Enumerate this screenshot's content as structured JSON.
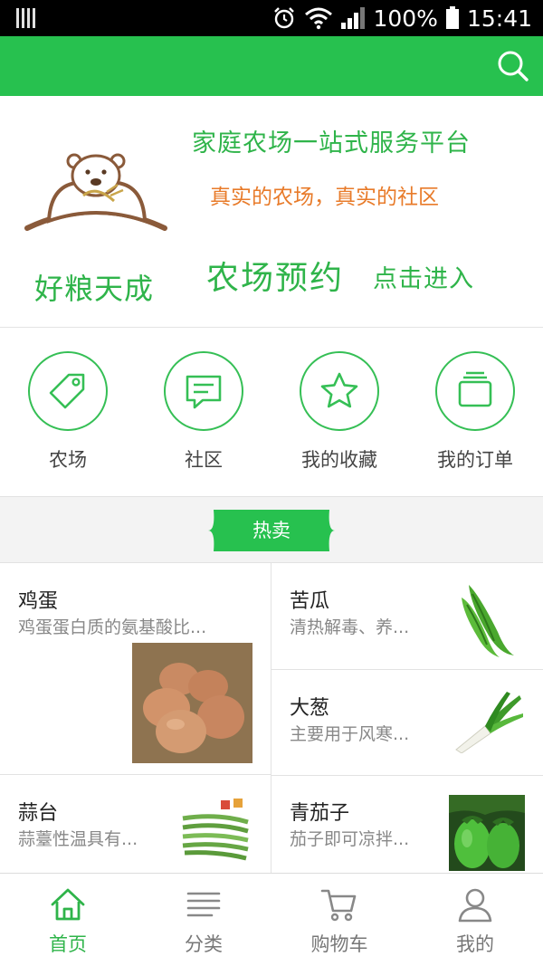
{
  "status_bar": {
    "battery": "100%",
    "time": "15:41"
  },
  "banner": {
    "brand": "好粮天成",
    "slogan_main": "家庭农场一站式服务平台",
    "slogan_sub": "真实的农场，真实的社区",
    "cta_main": "农场预约",
    "cta_sub": "点击进入"
  },
  "entries": [
    {
      "label": "农场",
      "icon": "tag-icon"
    },
    {
      "label": "社区",
      "icon": "chat-icon"
    },
    {
      "label": "我的收藏",
      "icon": "star-icon"
    },
    {
      "label": "我的订单",
      "icon": "orders-icon"
    }
  ],
  "hot": {
    "label": "热卖"
  },
  "products": [
    {
      "name": "鸡蛋",
      "desc": "鸡蛋蛋白质的氨基酸比..."
    },
    {
      "name": "苦瓜",
      "desc": "清热解毒、养..."
    },
    {
      "name": "大葱",
      "desc": "主要用于风寒..."
    },
    {
      "name": "蒜台",
      "desc": "蒜薹性温具有..."
    },
    {
      "name": "青茄子",
      "desc": "茄子即可凉拌..."
    }
  ],
  "nav": [
    {
      "label": "首页",
      "icon": "home-icon",
      "active": true
    },
    {
      "label": "分类",
      "icon": "list-icon",
      "active": false
    },
    {
      "label": "购物车",
      "icon": "cart-icon",
      "active": false
    },
    {
      "label": "我的",
      "icon": "user-icon",
      "active": false
    }
  ],
  "colors": {
    "primary": "#27c14f",
    "accent": "#e87b2a",
    "status_bar": "#000000"
  }
}
